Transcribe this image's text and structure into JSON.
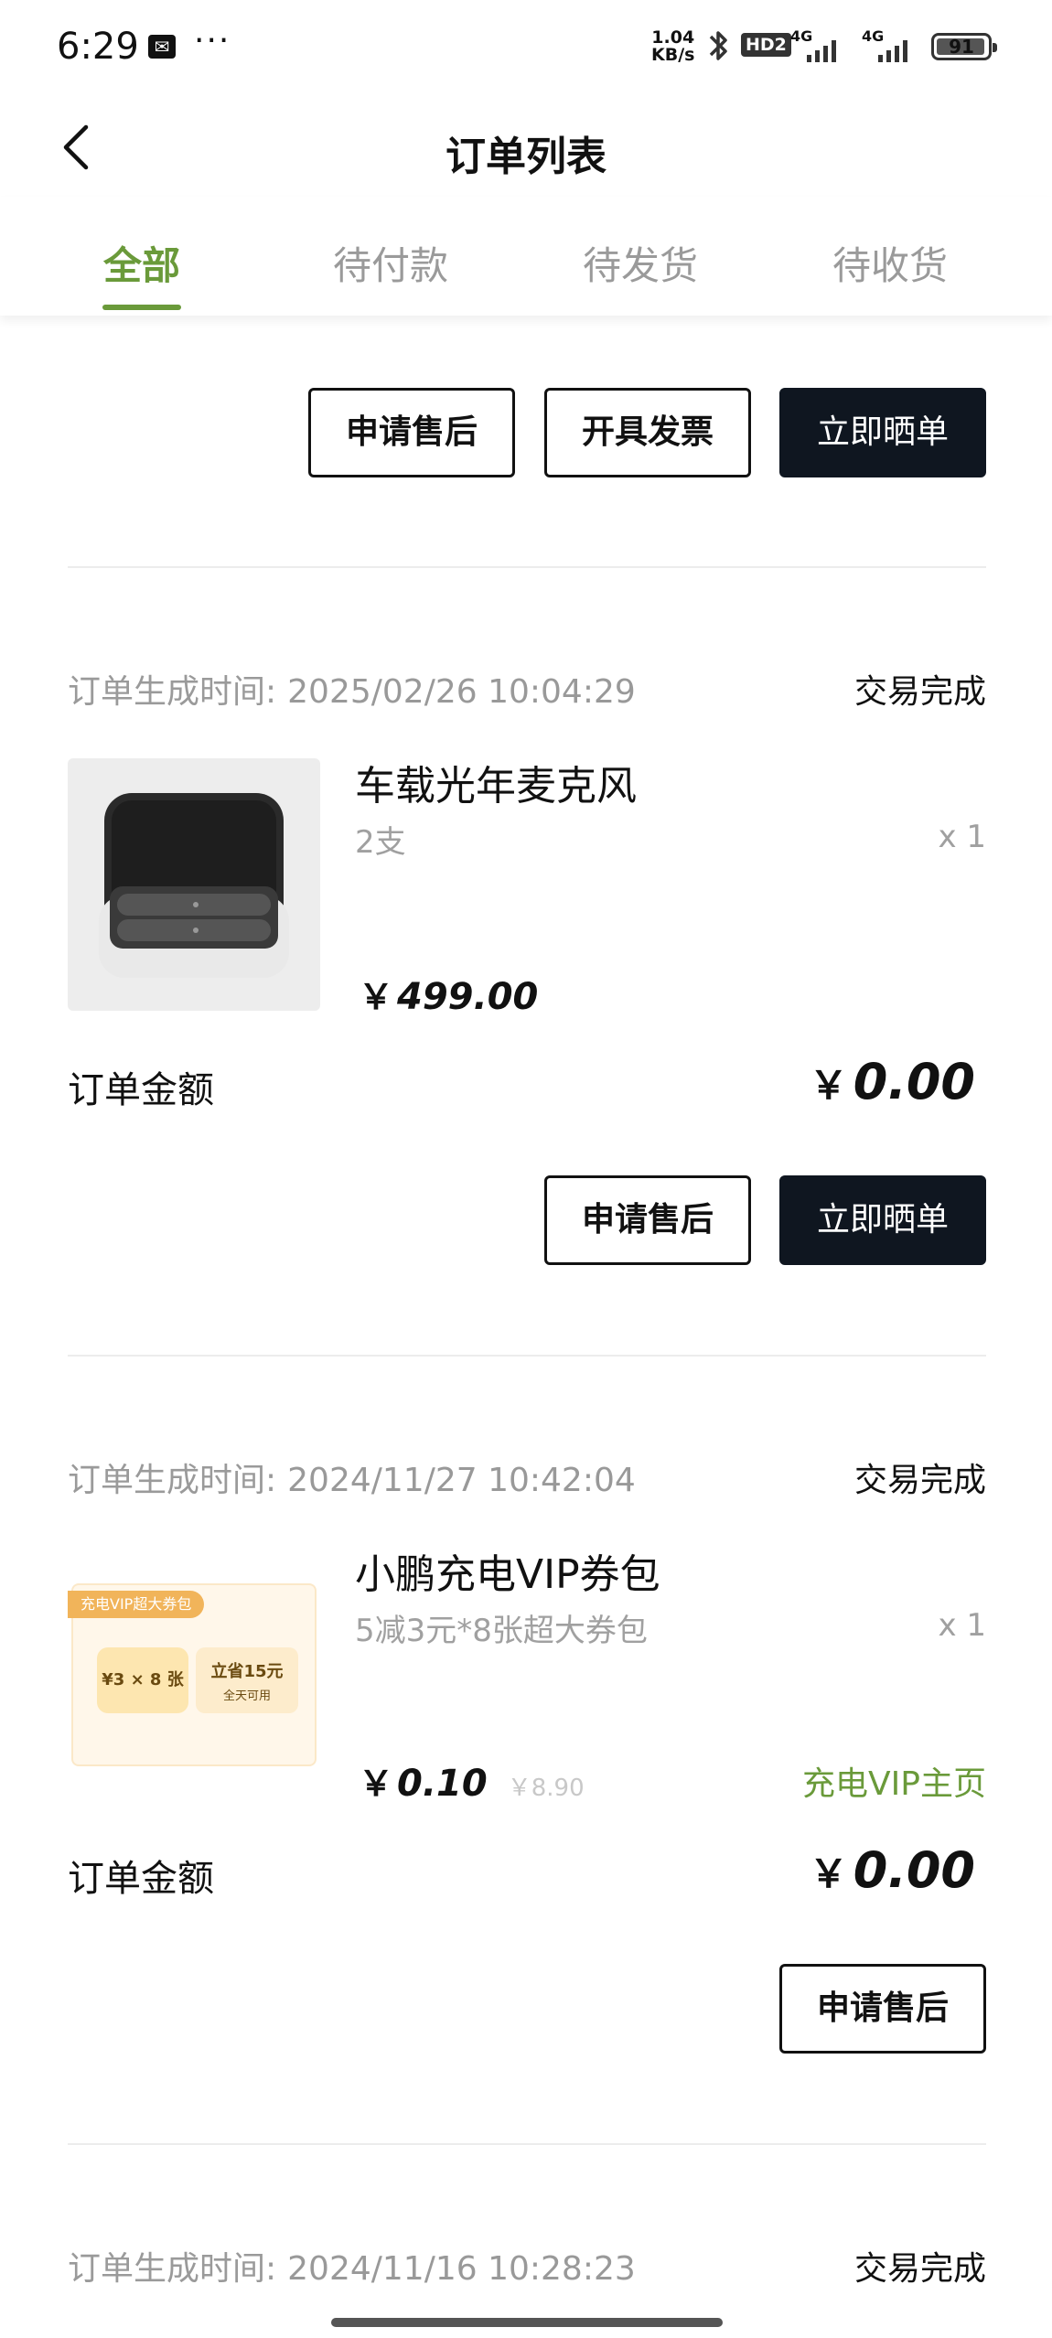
{
  "status_bar": {
    "time": "6:29",
    "app_icon": "message-icon",
    "more": "···",
    "net_speed_top": "1.04",
    "net_speed_bottom": "KB/s",
    "hd": "HD2",
    "signal1": "4G",
    "signal2": "4G",
    "battery": "91"
  },
  "header": {
    "title": "订单列表"
  },
  "tabs": [
    {
      "label": "全部",
      "active": true
    },
    {
      "label": "待付款"
    },
    {
      "label": "待发货"
    },
    {
      "label": "待收货"
    }
  ],
  "order0": {
    "buttons": [
      "申请售后",
      "开具发票",
      "立即晒单"
    ]
  },
  "order1": {
    "time_label": "订单生成时间:",
    "time": "2025/02/26 10:04:29",
    "status": "交易完成",
    "product": {
      "name": "车载光年麦克风",
      "spec": "2支",
      "qty": "x 1",
      "price_symbol": "￥",
      "price": "499.00"
    },
    "amount_label": "订单金额",
    "amount_symbol": "￥",
    "amount": "0.00",
    "buttons": [
      "申请售后",
      "立即晒单"
    ]
  },
  "order2": {
    "time_label": "订单生成时间:",
    "time": "2024/11/27 10:42:04",
    "status": "交易完成",
    "product": {
      "name": "小鹏充电VIP券包",
      "spec": "5减3元*8张超大券包",
      "qty": "x 1",
      "price_symbol": "￥",
      "price": "0.10",
      "original_price": "￥8.90",
      "link": "充电VIP主页",
      "thumb_tag": "充电VIP超大券包",
      "thumb_left": "¥3 × 8 张",
      "thumb_save": "立省15元",
      "thumb_sub": "全天可用"
    },
    "amount_label": "订单金额",
    "amount_symbol": "￥",
    "amount": "0.00",
    "buttons": [
      "申请售后"
    ]
  },
  "order3": {
    "time_label": "订单生成时间:",
    "time": "2024/11/16 10:28:23",
    "status": "交易完成"
  },
  "colors": {
    "accent": "#6a9a3a",
    "dark_button": "#0f1620",
    "muted_text": "#9a9a9a"
  }
}
